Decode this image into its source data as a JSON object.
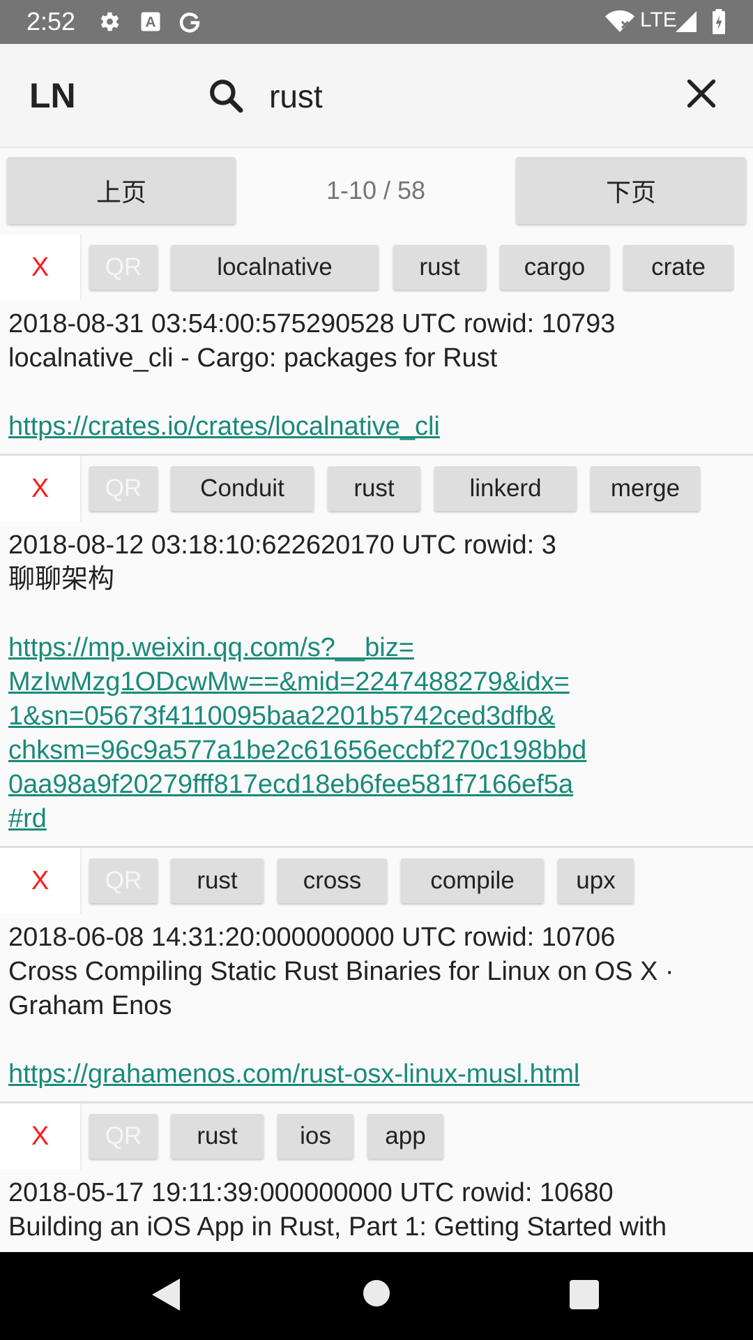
{
  "status_bar": {
    "time": "2:52",
    "network": "LTE",
    "icons": [
      "gear-icon",
      "a-icon",
      "google-icon",
      "wifi-icon",
      "signal-icon",
      "battery-icon"
    ]
  },
  "app_bar": {
    "title": "LN",
    "search_value": "rust",
    "search_icon": "search-icon",
    "clear_icon": "close-icon"
  },
  "pager": {
    "prev_label": "上页",
    "next_label": "下页",
    "info": "1-10 / 58"
  },
  "items": [
    {
      "delete_label": "X",
      "qr_label": "QR",
      "tags": [
        "localnative",
        "rust",
        "cargo",
        "crate"
      ],
      "meta": "2018-08-31 03:54:00:575290528 UTC rowid: 10793",
      "title_lines": [
        "localnative_cli - Cargo: packages for Rust"
      ],
      "url": "https://crates.io/crates/localnative_cli"
    },
    {
      "delete_label": "X",
      "qr_label": "QR",
      "tags": [
        "Conduit",
        "rust",
        "linkerd",
        "merge"
      ],
      "meta": "2018-08-12 03:18:10:622620170 UTC rowid: 3",
      "title_lines": [
        "聊聊架构"
      ],
      "url": "https://mp.weixin.qq.com/s?__biz=MzIwMzg1ODcwMw==&mid=2247488279&idx=1&sn=05673f4110095baa2201b5742ced3dfb&chksm=96c9a577a1be2c61656eccbf270c198bbd0aa98a9f20279fff817ecd18eb6fee581f7166ef5a#rd",
      "url_lines": [
        "https://mp.weixin.qq.com/s?__biz=",
        "MzIwMzg1ODcwMw==&mid=2247488279&idx=",
        "1&sn=05673f4110095baa2201b5742ced3dfb&",
        "chksm=96c9a577a1be2c61656eccbf270c198bbd",
        "0aa98a9f20279fff817ecd18eb6fee581f7166ef5a",
        "#rd"
      ]
    },
    {
      "delete_label": "X",
      "qr_label": "QR",
      "tags": [
        "rust",
        "cross",
        "compile",
        "upx"
      ],
      "meta": "2018-06-08 14:31:20:000000000 UTC rowid: 10706",
      "title_lines": [
        "Cross Compiling Static Rust Binaries for Linux on OS X ·",
        "Graham Enos"
      ],
      "url": "https://grahamenos.com/rust-osx-linux-musl.html"
    },
    {
      "delete_label": "X",
      "qr_label": "QR",
      "tags": [
        "rust",
        "ios",
        "app"
      ],
      "meta": "2018-05-17 19:11:39:000000000 UTC rowid: 10680",
      "title_lines": [
        "Building an iOS App in Rust, Part 1: Getting Started with"
      ]
    }
  ],
  "nav_bar": {
    "back_icon": "back-triangle-icon",
    "home_icon": "home-circle-icon",
    "recents_icon": "recents-square-icon"
  },
  "colors": {
    "status_bar": "#757575",
    "delete_text": "#ff1a1a",
    "link": "#1a8a7a",
    "tag_bg": "#dedede"
  }
}
